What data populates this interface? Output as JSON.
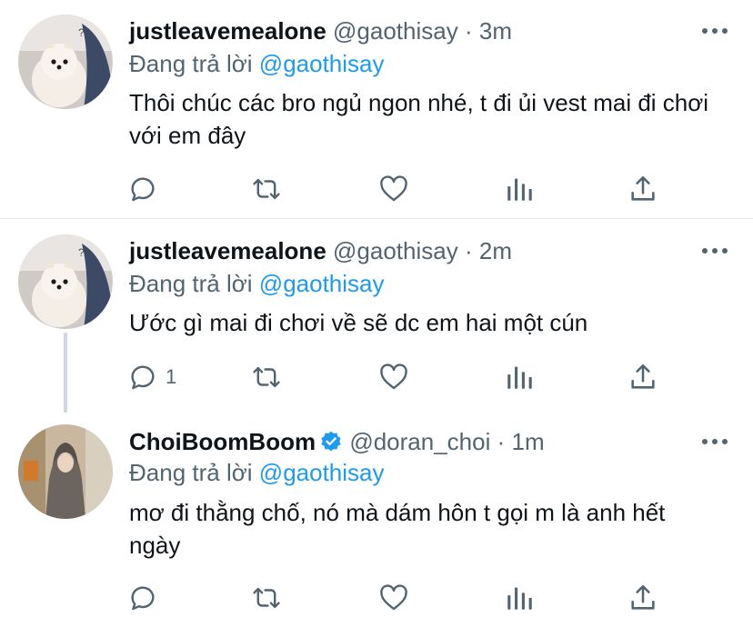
{
  "tweets": [
    {
      "display_name": "justleavemealone",
      "handle": "@gaothisay",
      "separator": "·",
      "time": "3m",
      "reply_prefix": "Đang trả lời",
      "reply_to": "@gaothisay",
      "text": "Thôi chúc các bro ngủ ngon nhé, t đi ủi vest mai đi chơi với em đây",
      "reply_count": "",
      "avatar": "pomeranian-dog"
    },
    {
      "display_name": "justleavemealone",
      "handle": "@gaothisay",
      "separator": "·",
      "time": "2m",
      "reply_prefix": "Đang trả lời",
      "reply_to": "@gaothisay",
      "text": "Ước gì mai đi chơi về sẽ dc em hai một cún",
      "reply_count": "1",
      "avatar": "pomeranian-dog"
    },
    {
      "display_name": "ChoiBoomBoom",
      "verified": true,
      "handle": "@doran_choi",
      "separator": "·",
      "time": "1m",
      "reply_prefix": "Đang trả lời",
      "reply_to": "@gaothisay",
      "text": "mơ đi thằng chố, nó mà dám hôn t gọi m là anh hết ngày",
      "reply_count": "",
      "avatar": "person-in-hoodie"
    }
  ],
  "icons": [
    "reply-icon",
    "retweet-icon",
    "like-icon",
    "analytics-icon",
    "share-icon",
    "more-icon",
    "verified-badge-icon"
  ],
  "colors": {
    "text": "#0f1419",
    "secondary": "#536471",
    "accent": "#1d9bf0"
  }
}
